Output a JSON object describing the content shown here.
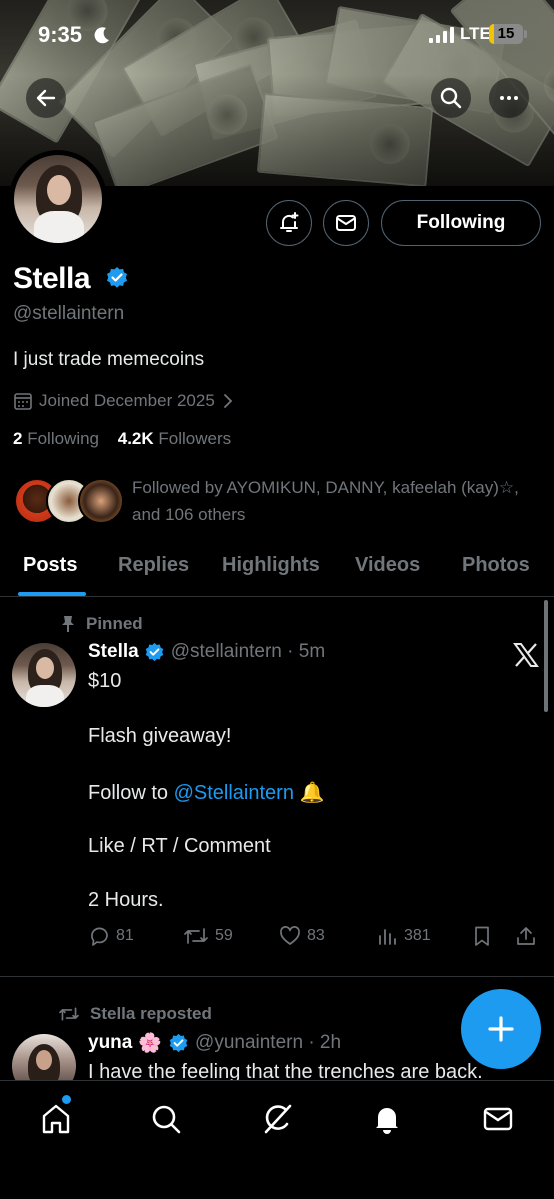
{
  "status_bar": {
    "time": "9:35",
    "network": "LTE",
    "battery": "15",
    "battery_level": 0.15
  },
  "header": {
    "back_icon": "arrow-left-icon",
    "search_icon": "search-icon",
    "more_icon": "more-horizontal-icon"
  },
  "profile": {
    "name": "Stella",
    "handle": "@stellaintern",
    "bio": "I just trade memecoins",
    "joined": "Joined December 2025",
    "following_count": "2",
    "following_label": "Following",
    "followers_count": "4.2K",
    "followers_label": "Followers",
    "followed_by": "Followed by AYOMIKUN, DANNY, kafeelah (kay)☆, and 106 others",
    "follow_button": "Following"
  },
  "tabs": [
    "Posts",
    "Replies",
    "Highlights",
    "Videos",
    "Photos"
  ],
  "pinned_tweet": {
    "pinned_label": "Pinned",
    "name": "Stella",
    "handle_time": "@stellaintern · 5m",
    "line1": "$10",
    "line2": "Flash giveaway!",
    "line3_prefix": "Follow to ",
    "line3_mention": "@Stellaintern",
    "line3_emoji": "🔔",
    "line4": "Like / RT / Comment",
    "line5": "2 Hours.",
    "replies": "81",
    "reposts": "59",
    "likes": "83",
    "views": "381"
  },
  "repost_tweet": {
    "repost_label": "Stella reposted",
    "name": "yuna",
    "emoji": "🌸",
    "handle_time": "@yunaintern · 2h",
    "text": "I have the feeling that the trenches are back."
  },
  "colors": {
    "accent": "#1d9bf0",
    "background": "#000000",
    "muted": "#71767b"
  }
}
